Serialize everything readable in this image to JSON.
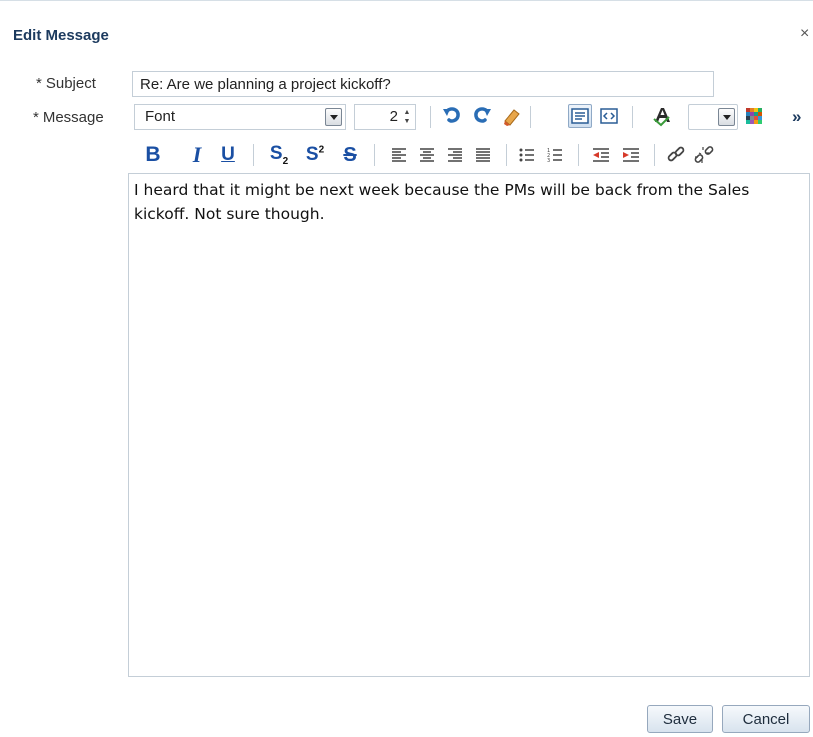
{
  "dialog": {
    "title": "Edit Message",
    "close_glyph": "×"
  },
  "form": {
    "subject_label": "Subject",
    "subject_required": "*",
    "subject_value": "Re: Are we planning a project kickoff?",
    "message_label": "Message",
    "message_required": "*"
  },
  "toolbar": {
    "font_value": "Font",
    "size_value": "2",
    "more_glyph": "»",
    "icons_row1": [
      "undo-icon",
      "redo-icon",
      "clear-formatting-icon",
      "rich-text-mode-icon",
      "source-code-mode-icon",
      "text-color-icon",
      "background-color-icon"
    ],
    "icons_row2": [
      "bold-icon",
      "italic-icon",
      "underline-icon",
      "subscript-icon",
      "superscript-icon",
      "strikethrough-icon",
      "align-left-icon",
      "align-center-icon",
      "align-right-icon",
      "justify-icon",
      "bulleted-list-icon",
      "numbered-list-icon",
      "outdent-icon",
      "indent-icon",
      "link-icon",
      "unlink-icon"
    ]
  },
  "editor": {
    "content": "I heard that it might be next week because the PMs will be back from the Sales kickoff. Not sure though."
  },
  "buttons": {
    "save": "Save",
    "cancel": "Cancel"
  },
  "colors": {
    "title": "#1c3a5e",
    "border": "#c4ced7",
    "bold_icon": "#1a4fa3"
  }
}
